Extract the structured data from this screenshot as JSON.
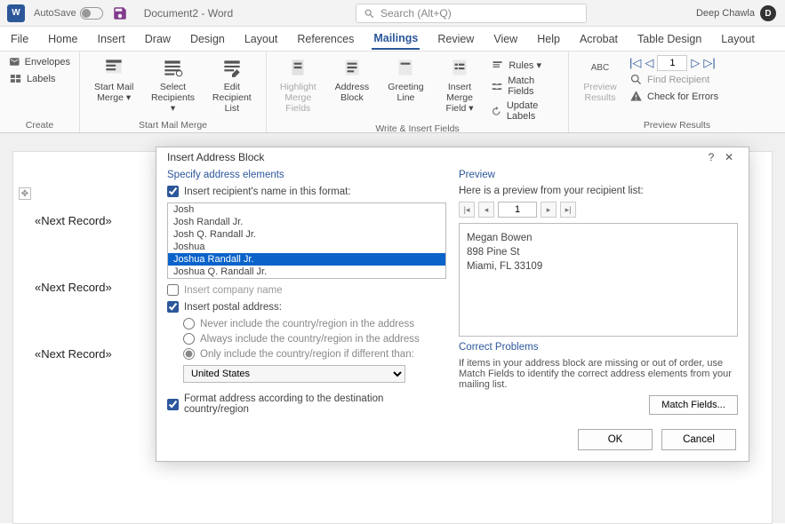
{
  "titlebar": {
    "autosave": "AutoSave",
    "doc": "Document2 - Word",
    "search_placeholder": "Search (Alt+Q)",
    "user": "Deep Chawla",
    "user_initial": "D"
  },
  "menu": [
    "File",
    "Home",
    "Insert",
    "Draw",
    "Design",
    "Layout",
    "References",
    "Mailings",
    "Review",
    "View",
    "Help",
    "Acrobat",
    "Table Design",
    "Layout"
  ],
  "menu_active": "Mailings",
  "ribbon": {
    "create": {
      "envelopes": "Envelopes",
      "labels": "Labels",
      "group": "Create"
    },
    "start": {
      "start_mm": "Start Mail Merge ▾",
      "select_rec": "Select Recipients ▾",
      "edit_rec": "Edit Recipient List",
      "group": "Start Mail Merge"
    },
    "write": {
      "highlight": "Highlight Merge Fields",
      "addr": "Address Block",
      "greet": "Greeting Line",
      "insert_mf": "Insert Merge Field ▾",
      "rules": "Rules ▾",
      "match": "Match Fields",
      "update": "Update Labels",
      "group": "Write & Insert Fields"
    },
    "preview": {
      "abc": "Preview Results",
      "find": "Find Recipient",
      "check": "Check for Errors",
      "num": "1",
      "group": "Preview Results"
    }
  },
  "doc": {
    "next": "«Next Record»"
  },
  "dialog": {
    "title": "Insert Address Block",
    "specify": "Specify address elements",
    "insert_name": "Insert recipient's name in this format:",
    "names": [
      "Josh",
      "Josh Randall Jr.",
      "Josh Q. Randall Jr.",
      "Joshua",
      "Joshua Randall Jr.",
      "Joshua Q. Randall Jr."
    ],
    "selected_name_idx": 4,
    "insert_company": "Insert company name",
    "insert_postal": "Insert postal address:",
    "r1": "Never include the country/region in the address",
    "r2": "Always include the country/region in the address",
    "r3": "Only include the country/region if different than:",
    "country": "United States",
    "format_dest": "Format address according to the destination country/region",
    "preview": "Preview",
    "preview_hint": "Here is a preview from your recipient list:",
    "preview_num": "1",
    "preview_lines": [
      "Megan Bowen",
      "898 Pine St",
      "Miami, FL  33109"
    ],
    "correct_h": "Correct Problems",
    "correct_txt": "If items in your address block are missing or out of order, use Match Fields to identify the correct address elements from your mailing list.",
    "match_btn": "Match Fields...",
    "ok": "OK",
    "cancel": "Cancel"
  }
}
